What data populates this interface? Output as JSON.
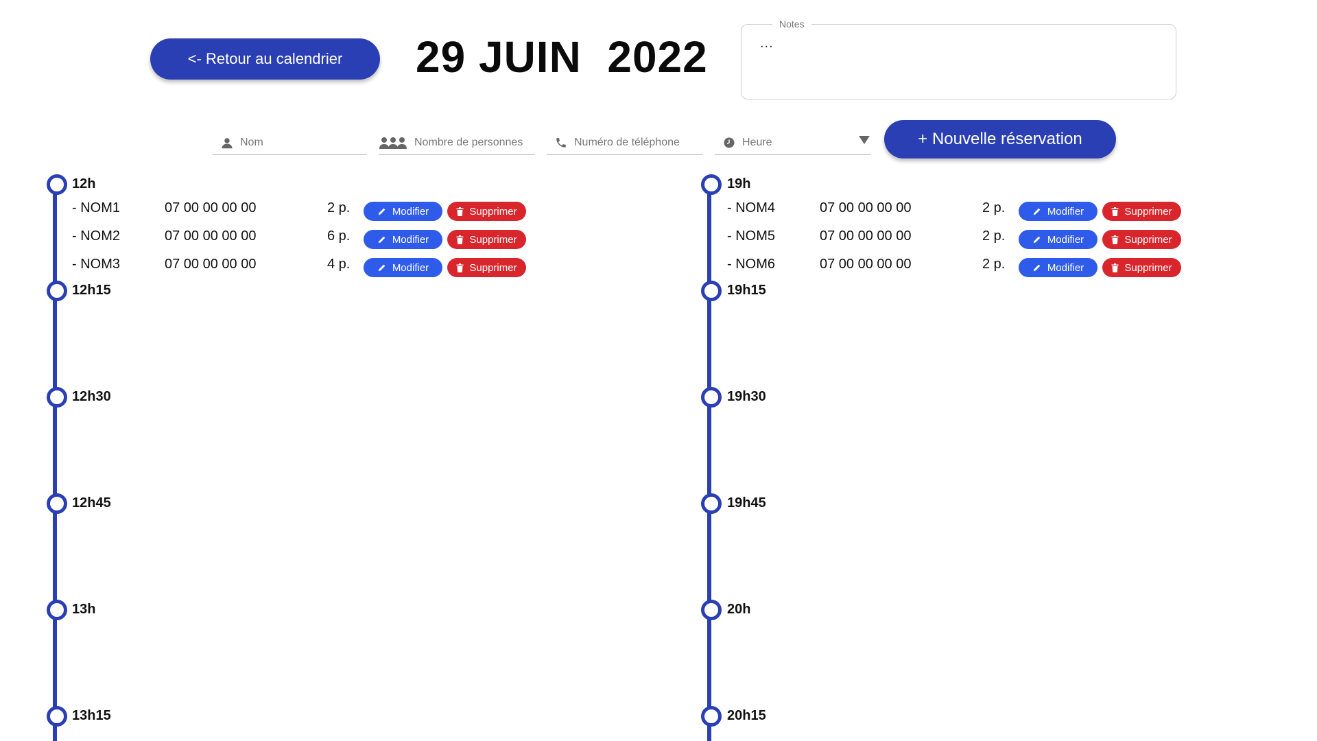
{
  "header": {
    "back_label": "<- Retour au calendrier",
    "date": "29 JUIN  2022",
    "notes_label": "Notes",
    "notes_value": "..."
  },
  "form": {
    "name_placeholder": "Nom",
    "people_placeholder": "Nombre de personnes",
    "phone_placeholder": "Numéro de téléphone",
    "time_placeholder": "Heure",
    "new_button": "+ Nouvelle réservation"
  },
  "icons": {
    "name": "person-icon",
    "people": "group-icon",
    "phone": "phone-icon",
    "time": "clock-icon",
    "time_dropdown": "caret-down-icon",
    "modify": "pencil-icon",
    "delete": "trash-icon"
  },
  "colors": {
    "primary": "#2a3fb4",
    "modify": "#2f5bea",
    "delete": "#d9262c"
  },
  "actions": {
    "modify_label": "Modifier",
    "delete_label": "Supprimer"
  },
  "lunch": {
    "slots": [
      "12h",
      "12h15",
      "12h30",
      "12h45",
      "13h",
      "13h15"
    ],
    "reservations": [
      {
        "name": "- NOM1",
        "phone": "07 00 00 00 00",
        "people": "2 p."
      },
      {
        "name": "- NOM2",
        "phone": "07 00 00 00 00",
        "people": "6 p."
      },
      {
        "name": "- NOM3",
        "phone": "07 00 00 00 00",
        "people": "4 p."
      }
    ]
  },
  "dinner": {
    "slots": [
      "19h",
      "19h15",
      "19h30",
      "19h45",
      "20h",
      "20h15"
    ],
    "reservations": [
      {
        "name": "- NOM4",
        "phone": "07 00 00 00 00",
        "people": "2 p."
      },
      {
        "name": "- NOM5",
        "phone": "07 00 00 00 00",
        "people": "2 p."
      },
      {
        "name": "- NOM6",
        "phone": "07 00 00 00 00",
        "people": "2 p."
      }
    ]
  }
}
